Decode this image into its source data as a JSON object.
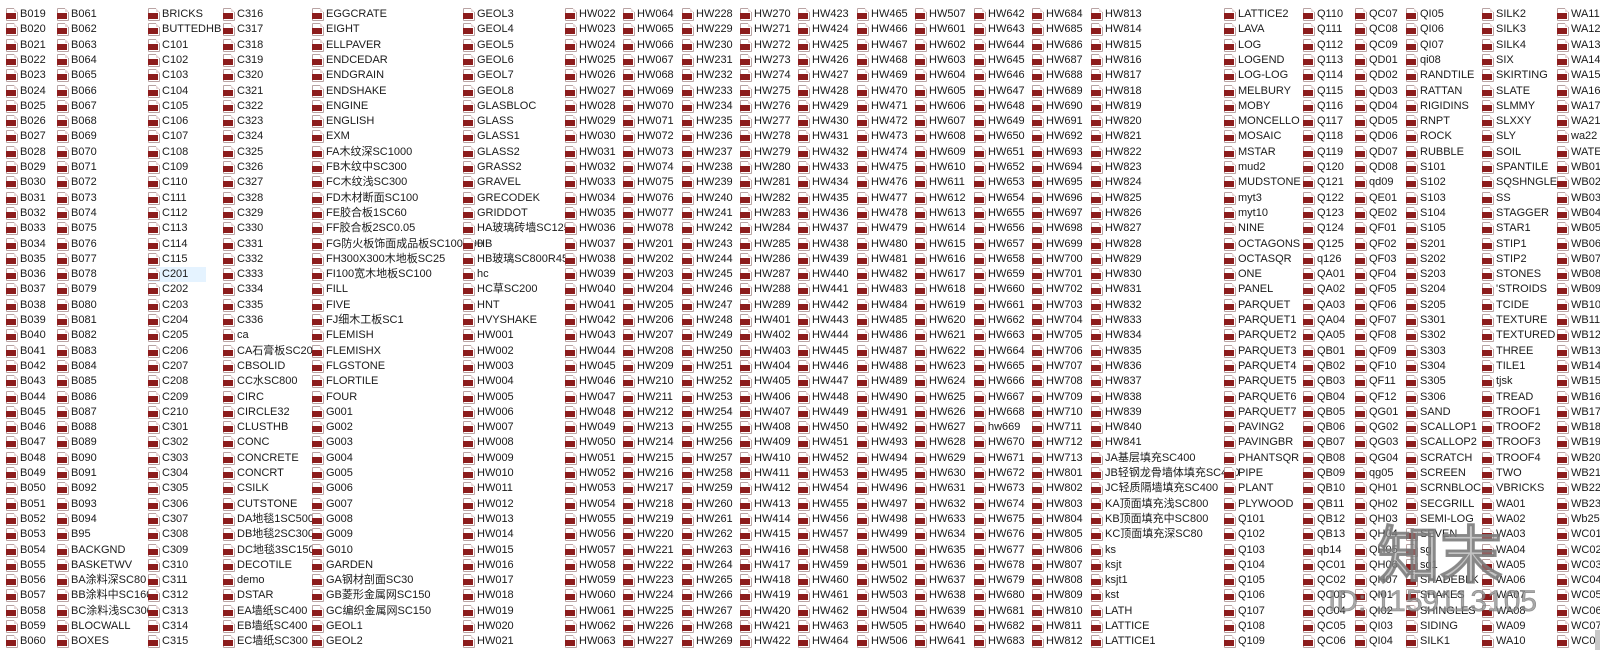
{
  "file_icon": "pat-file-icon",
  "selected_item": "C201",
  "colors": {
    "selection": "#e5f3ff",
    "icon_band": "#8c1c1c"
  },
  "watermark": {
    "logo": "知末",
    "id_text": "ID: 1159113105"
  },
  "columns": [
    [
      "B019",
      "B020",
      "B021",
      "B022",
      "B023",
      "B024",
      "B025",
      "B026",
      "B027",
      "B028",
      "B029",
      "B030",
      "B031",
      "B032",
      "B033",
      "B034",
      "B035",
      "B036",
      "B037",
      "B038",
      "B039",
      "B040",
      "B041",
      "B042",
      "B043",
      "B044",
      "B045",
      "B046",
      "B047",
      "B048",
      "B049",
      "B050",
      "B051",
      "B052",
      "B053",
      "B054",
      "B055",
      "B056",
      "B057",
      "B058",
      "B059",
      "B060"
    ],
    [
      "B061",
      "B062",
      "B063",
      "B064",
      "B065",
      "B066",
      "B067",
      "B068",
      "B069",
      "B070",
      "B071",
      "B072",
      "B073",
      "B074",
      "B075",
      "B076",
      "B077",
      "B078",
      "B079",
      "B080",
      "B081",
      "B082",
      "B083",
      "B084",
      "B085",
      "B086",
      "B087",
      "B088",
      "B089",
      "B090",
      "B091",
      "B092",
      "B093",
      "B094",
      "B95",
      "BACKGND",
      "BASKETWV",
      "BA涂料深SC80",
      "BB涂料中SC160",
      "BC涂料浅SC300",
      "BLOCWALL",
      "BOXES"
    ],
    [
      "BRICKS",
      "BUTTEDHB",
      "C101",
      "C102",
      "C103",
      "C104",
      "C105",
      "C106",
      "C107",
      "C108",
      "C109",
      "C110",
      "C111",
      "C112",
      "C113",
      "C114",
      "C115",
      "C201",
      "C202",
      "C203",
      "C204",
      "C205",
      "C206",
      "C207",
      "C208",
      "C209",
      "C210",
      "C301",
      "C302",
      "C303",
      "C304",
      "C305",
      "C306",
      "C307",
      "C308",
      "C309",
      "C310",
      "C311",
      "C312",
      "C313",
      "C314",
      "C315"
    ],
    [
      "C316",
      "C317",
      "C318",
      "C319",
      "C320",
      "C321",
      "C322",
      "C323",
      "C324",
      "C325",
      "C326",
      "C327",
      "C328",
      "C329",
      "C330",
      "C331",
      "C332",
      "C333",
      "C334",
      "C335",
      "C336",
      "ca",
      "CA石膏板SC20",
      "CBSOLID",
      "CC水SC800",
      "CIRC",
      "CIRCLE32",
      "CLUSTHB",
      "CONC",
      "CONCRETE",
      "CONCRT",
      "CSILK",
      "CUTSTONE",
      "DA地毯1SC500",
      "DB地毯2SC300",
      "DC地毯3SC150",
      "DECOTILE",
      "demo",
      "DSTAR",
      "EA墙纸SC400",
      "EB墙纸SC400",
      "EC墙纸SC300"
    ],
    [
      "EGGCRATE",
      "EIGHT",
      "ELLPAVER",
      "ENDCEDAR",
      "ENDGRAIN",
      "ENDSHAKE",
      "ENGINE",
      "ENGLISH",
      "EXM",
      "FA木纹深SC1000",
      "FB木纹中SC300",
      "FC木纹浅SC300",
      "FD木材断面SC100",
      "FE胶合板1SC60",
      "FF胶合板2SC0.05",
      "FG防火板饰面成品板SC100R90",
      "FH300X300木地板SC25",
      "FI100宽木地板SC100",
      "FILL",
      "FIVE",
      "FJ细木工板SC1",
      "FLEMISH",
      "FLEMISHX",
      "FLGSTONE",
      "FLORTILE",
      "FOUR",
      "G001",
      "G002",
      "G003",
      "G004",
      "G005",
      "G006",
      "G007",
      "G008",
      "G009",
      "G010",
      "GARDEN",
      "GA钢材剖面SC30",
      "GB菱形金属网SC150",
      "GC编织金属网SC150",
      "GEOL1",
      "GEOL2"
    ],
    [
      "GEOL3",
      "GEOL4",
      "GEOL5",
      "GEOL6",
      "GEOL7",
      "GEOL8",
      "GLASBLOC",
      "GLASS",
      "GLASS1",
      "GLASS2",
      "GRASS2",
      "GRAVEL",
      "GRECODEK",
      "GRIDDOT",
      "HA玻璃砖墙SC125",
      "HB",
      "HB玻璃SC800R45",
      "hc",
      "HC草SC200",
      "HNT",
      "HVYSHAKE",
      "HW001",
      "HW002",
      "HW003",
      "HW004",
      "HW005",
      "HW006",
      "HW007",
      "HW008",
      "HW009",
      "HW010",
      "HW011",
      "HW012",
      "HW013",
      "HW014",
      "HW015",
      "HW016",
      "HW017",
      "HW018",
      "HW019",
      "HW020",
      "HW021"
    ],
    [
      "HW022",
      "HW023",
      "HW024",
      "HW025",
      "HW026",
      "HW027",
      "HW028",
      "HW029",
      "HW030",
      "HW031",
      "HW032",
      "HW033",
      "HW034",
      "HW035",
      "HW036",
      "HW037",
      "HW038",
      "HW039",
      "HW040",
      "HW041",
      "HW042",
      "HW043",
      "HW044",
      "HW045",
      "HW046",
      "HW047",
      "HW048",
      "HW049",
      "HW050",
      "HW051",
      "HW052",
      "HW053",
      "HW054",
      "HW055",
      "HW056",
      "HW057",
      "HW058",
      "HW059",
      "HW060",
      "HW061",
      "HW062",
      "HW063"
    ],
    [
      "HW064",
      "HW065",
      "HW066",
      "HW067",
      "HW068",
      "HW069",
      "HW070",
      "HW071",
      "HW072",
      "HW073",
      "HW074",
      "HW075",
      "HW076",
      "HW077",
      "HW078",
      "HW201",
      "HW202",
      "HW203",
      "HW204",
      "HW205",
      "HW206",
      "HW207",
      "HW208",
      "HW209",
      "HW210",
      "HW211",
      "HW212",
      "HW213",
      "HW214",
      "HW215",
      "HW216",
      "HW217",
      "HW218",
      "HW219",
      "HW220",
      "HW221",
      "HW222",
      "HW223",
      "HW224",
      "HW225",
      "HW226",
      "HW227"
    ],
    [
      "HW228",
      "HW229",
      "HW230",
      "HW231",
      "HW232",
      "HW233",
      "HW234",
      "HW235",
      "HW236",
      "HW237",
      "HW238",
      "HW239",
      "HW240",
      "HW241",
      "HW242",
      "HW243",
      "HW244",
      "HW245",
      "HW246",
      "HW247",
      "HW248",
      "HW249",
      "HW250",
      "HW251",
      "HW252",
      "HW253",
      "HW254",
      "HW255",
      "HW256",
      "HW257",
      "HW258",
      "HW259",
      "HW260",
      "HW261",
      "HW262",
      "HW263",
      "HW264",
      "HW265",
      "HW266",
      "HW267",
      "HW268",
      "HW269"
    ],
    [
      "HW270",
      "HW271",
      "HW272",
      "HW273",
      "HW274",
      "HW275",
      "HW276",
      "HW277",
      "HW278",
      "HW279",
      "HW280",
      "HW281",
      "HW282",
      "HW283",
      "HW284",
      "HW285",
      "HW286",
      "HW287",
      "HW288",
      "HW289",
      "HW401",
      "HW402",
      "HW403",
      "HW404",
      "HW405",
      "HW406",
      "HW407",
      "HW408",
      "HW409",
      "HW410",
      "HW411",
      "HW412",
      "HW413",
      "HW414",
      "HW415",
      "HW416",
      "HW417",
      "HW418",
      "HW419",
      "HW420",
      "HW421",
      "HW422"
    ],
    [
      "HW423",
      "HW424",
      "HW425",
      "HW426",
      "HW427",
      "HW428",
      "HW429",
      "HW430",
      "HW431",
      "HW432",
      "HW433",
      "HW434",
      "HW435",
      "HW436",
      "HW437",
      "HW438",
      "HW439",
      "HW440",
      "HW441",
      "HW442",
      "HW443",
      "HW444",
      "HW445",
      "HW446",
      "HW447",
      "HW448",
      "HW449",
      "HW450",
      "HW451",
      "HW452",
      "HW453",
      "HW454",
      "HW455",
      "HW456",
      "HW457",
      "HW458",
      "HW459",
      "HW460",
      "HW461",
      "HW462",
      "HW463",
      "HW464"
    ],
    [
      "HW465",
      "HW466",
      "HW467",
      "HW468",
      "HW469",
      "HW470",
      "HW471",
      "HW472",
      "HW473",
      "HW474",
      "HW475",
      "HW476",
      "HW477",
      "HW478",
      "HW479",
      "HW480",
      "HW481",
      "HW482",
      "HW483",
      "HW484",
      "HW485",
      "HW486",
      "HW487",
      "HW488",
      "HW489",
      "HW490",
      "HW491",
      "HW492",
      "HW493",
      "HW494",
      "HW495",
      "HW496",
      "HW497",
      "HW498",
      "HW499",
      "HW500",
      "HW501",
      "HW502",
      "HW503",
      "HW504",
      "HW505",
      "HW506"
    ],
    [
      "HW507",
      "HW601",
      "HW602",
      "HW603",
      "HW604",
      "HW605",
      "HW606",
      "HW607",
      "HW608",
      "HW609",
      "HW610",
      "HW611",
      "HW612",
      "HW613",
      "HW614",
      "HW615",
      "HW616",
      "HW617",
      "HW618",
      "HW619",
      "HW620",
      "HW621",
      "HW622",
      "HW623",
      "HW624",
      "HW625",
      "HW626",
      "HW627",
      "HW628",
      "HW629",
      "HW630",
      "HW631",
      "HW632",
      "HW633",
      "HW634",
      "HW635",
      "HW636",
      "HW637",
      "HW638",
      "HW639",
      "HW640",
      "HW641"
    ],
    [
      "HW642",
      "HW643",
      "HW644",
      "HW645",
      "HW646",
      "HW647",
      "HW648",
      "HW649",
      "HW650",
      "HW651",
      "HW652",
      "HW653",
      "HW654",
      "HW655",
      "HW656",
      "HW657",
      "HW658",
      "HW659",
      "HW660",
      "HW661",
      "HW662",
      "HW663",
      "HW664",
      "HW665",
      "HW666",
      "HW667",
      "HW668",
      "hw669",
      "HW670",
      "HW671",
      "HW672",
      "HW673",
      "HW674",
      "HW675",
      "HW676",
      "HW677",
      "HW678",
      "HW679",
      "HW680",
      "HW681",
      "HW682",
      "HW683"
    ],
    [
      "HW684",
      "HW685",
      "HW686",
      "HW687",
      "HW688",
      "HW689",
      "HW690",
      "HW691",
      "HW692",
      "HW693",
      "HW694",
      "HW695",
      "HW696",
      "HW697",
      "HW698",
      "HW699",
      "HW700",
      "HW701",
      "HW702",
      "HW703",
      "HW704",
      "HW705",
      "HW706",
      "HW707",
      "HW708",
      "HW709",
      "HW710",
      "HW711",
      "HW712",
      "HW713",
      "HW801",
      "HW802",
      "HW803",
      "HW804",
      "HW805",
      "HW806",
      "HW807",
      "HW808",
      "HW809",
      "HW810",
      "HW811",
      "HW812"
    ],
    [
      "HW813",
      "HW814",
      "HW815",
      "HW816",
      "HW817",
      "HW818",
      "HW819",
      "HW820",
      "HW821",
      "HW822",
      "HW823",
      "HW824",
      "HW825",
      "HW826",
      "HW827",
      "HW828",
      "HW829",
      "HW830",
      "HW831",
      "HW832",
      "HW833",
      "HW834",
      "HW835",
      "HW836",
      "HW837",
      "HW838",
      "HW839",
      "HW840",
      "HW841",
      "JA基层填充SC400",
      "JB轻钢龙骨墙体填充SC400",
      "JC轻质隔墙填充SC400",
      "KA顶面填充浅SC800",
      "KB顶面填充中SC800",
      "KC顶面填充深SC80",
      "ks",
      "ksjt",
      "ksjt1",
      "kst",
      "LATH",
      "LATTICE",
      "LATTICE1"
    ],
    [
      "LATTICE2",
      "LAVA",
      "LOG",
      "LOGEND",
      "LOG-LOG",
      "MELBURY",
      "MOBY",
      "MONCELLO",
      "MOSAIC",
      "MSTAR",
      "mud2",
      "MUDSTONE",
      "myt3",
      "myt10",
      "NINE",
      "OCTAGONS",
      "OCTASQR",
      "ONE",
      "PANEL",
      "PARQUET",
      "PARQUET1",
      "PARQUET2",
      "PARQUET3",
      "PARQUET4",
      "PARQUET5",
      "PARQUET6",
      "PARQUET7",
      "PAVING2",
      "PAVINGBR",
      "PHANTSQR",
      "PIPE",
      "PLANT",
      "PLYWOOD",
      "Q101",
      "Q102",
      "Q103",
      "Q104",
      "Q105",
      "Q106",
      "Q107",
      "Q108",
      "Q109"
    ],
    [
      "Q110",
      "Q111",
      "Q112",
      "Q113",
      "Q114",
      "Q115",
      "Q116",
      "Q117",
      "Q118",
      "Q119",
      "Q120",
      "Q121",
      "Q122",
      "Q123",
      "Q124",
      "Q125",
      "q126",
      "QA01",
      "QA02",
      "QA03",
      "QA04",
      "QA05",
      "QB01",
      "QB02",
      "QB03",
      "QB04",
      "QB05",
      "QB06",
      "QB07",
      "QB08",
      "QB09",
      "QB10",
      "QB11",
      "QB12",
      "QB13",
      "qb14",
      "QC01",
      "QC02",
      "QC03",
      "QC04",
      "QC05",
      "QC06"
    ],
    [
      "QC07",
      "QC08",
      "QC09",
      "QD01",
      "QD02",
      "QD03",
      "QD04",
      "QD05",
      "QD06",
      "QD07",
      "QD08",
      "qd09",
      "QE01",
      "QE02",
      "QF01",
      "QF02",
      "QF03",
      "QF04",
      "QF05",
      "QF06",
      "QF07",
      "QF08",
      "QF09",
      "QF10",
      "QF11",
      "QF12",
      "QG01",
      "QG02",
      "QG03",
      "QG04",
      "qg05",
      "QH01",
      "QH02",
      "QH03",
      "QH04",
      "QH05",
      "QH06",
      "QH07",
      "QI01",
      "QI02",
      "QI03",
      "QI04"
    ],
    [
      "QI05",
      "QI06",
      "QI07",
      "qi08",
      "RANDTILE",
      "RATTAN",
      "RIGIDINS",
      "RNPT",
      "ROCK",
      "RUBBLE",
      "S101",
      "S102",
      "S103",
      "S104",
      "S105",
      "S201",
      "S202",
      "S203",
      "S204",
      "S205",
      "S301",
      "S302",
      "S303",
      "S304",
      "S305",
      "S306",
      "SAND",
      "SCALLOP1",
      "SCALLOP2",
      "SCRATCH",
      "SCREEN",
      "SCRNBLOC",
      "SECGRILL",
      "SEMI-LOG",
      "SEVEN",
      "sg",
      "sg1",
      "SHADEBLK",
      "SHAKES",
      "SHINGLES",
      "SIDING",
      "SILK1"
    ],
    [
      "SILK2",
      "SILK3",
      "SILK4",
      "SIX",
      "SKIRTING",
      "SLATE",
      "SLMMY",
      "SLXXY",
      "SLY",
      "SOIL",
      "SPANTILE",
      "SQSHNGLE",
      "SS",
      "STAGGER",
      "STAR1",
      "STIP1",
      "STIP2",
      "STONES",
      "'STROIDS",
      "TCIDE",
      "TEXTURE",
      "TEXTURED",
      "THREE",
      "TILE1",
      "tjsk",
      "TREAD",
      "TROOF1",
      "TROOF2",
      "TROOF3",
      "TROOF4",
      "TWO",
      "VBRICKS",
      "WA01",
      "WA02",
      "WA03",
      "WA04",
      "WA05",
      "WA06",
      "WA07",
      "WA08",
      "WA09",
      "WA10"
    ],
    [
      "WA11",
      "WA12",
      "WA13",
      "WA14",
      "WA15",
      "WA16",
      "WA17",
      "WA21",
      "wa22",
      "WATER",
      "WB01",
      "WB02",
      "WB03",
      "WB04",
      "WB05",
      "WB06",
      "WB07",
      "WB08",
      "WB09",
      "WB10",
      "WB11",
      "WB12",
      "WB13",
      "WB14",
      "WB15",
      "WB16",
      "WB17",
      "WB18",
      "WB19",
      "WB20",
      "WB21",
      "WB22",
      "WB23",
      "Wb25",
      "WC01",
      "WC02",
      "WC03",
      "WC04",
      "WC05",
      "WC06",
      "WC07",
      "WC08"
    ]
  ]
}
